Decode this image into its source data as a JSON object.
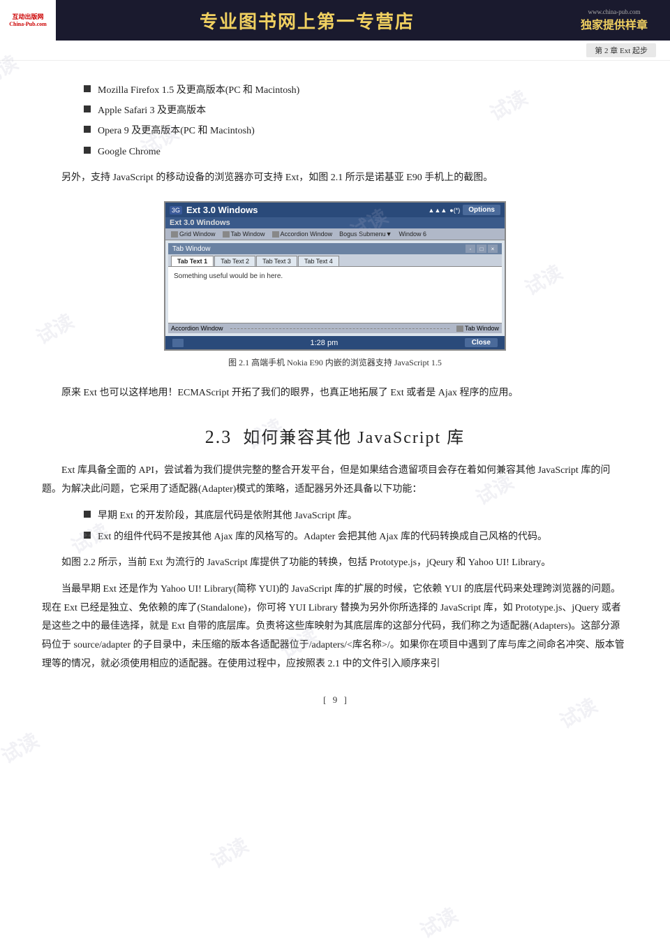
{
  "header": {
    "logo_top": "互动出版网",
    "logo_sub": "China-Pub.com",
    "center_title": "专业图书网上第一专营店",
    "right_url": "www.china-pub.com",
    "right_slogan": "独家提供样章"
  },
  "chapter_tag": "第 2 章   Ext 起步",
  "bullet_items": [
    "Mozilla Firefox 1.5 及更高版本(PC 和 Macintosh)",
    "Apple Safari 3 及更高版本",
    "Opera 9 及更高版本(PC 和 Macintosh)",
    "Google Chrome"
  ],
  "para_intro": "另外，支持 JavaScript 的移动设备的浏览器亦可支持 Ext，如图 2.1 所示是诺基亚 E90 手机上的截图。",
  "figure": {
    "top_bar_signal": "3G",
    "top_bar_title": "Ext 3.0 Windows",
    "top_bar_wifi": "▲▲▲",
    "top_bar_battery": "●(*)",
    "options_label": "Options",
    "ext_windows_label": "Ext 3.0 Windows",
    "menu_items": [
      "Grid Window",
      "Tab Window",
      "Accordion Window",
      "Bogus Submenu▼",
      "Window 6"
    ],
    "tab_window_title": "Tab Window",
    "win_buttons": [
      "-",
      "□",
      "×"
    ],
    "tabs": [
      "Tab Text 1",
      "Tab Text 2",
      "Tab Text 3",
      "Tab Text 4"
    ],
    "active_tab": 0,
    "tab_content": "Something useful would be in here.",
    "accordion_label": "Accordion Window",
    "tab_window_label2": "Tab Window",
    "phone_time": "1:28 pm",
    "close_label": "Close"
  },
  "figure_caption": "图 2.1    高端手机 Nokia E90 内嵌的浏览器支持 JavaScript 1.5",
  "para_after_figure": "原来 Ext 也可以这样地用！ECMAScript 开拓了我们的眼界，也真正地拓展了 Ext 或者是 Ajax 程序的应用。",
  "section": {
    "number": "2.3",
    "title": "如何兼容其他 JavaScript 库"
  },
  "paragraphs": [
    "Ext 库具备全面的 API，尝试着为我们提供完整的整合开发平台，但是如果结合遗留项目会存在着如何兼容其他 JavaScript 库的问题。为解决此问题，它采用了适配器(Adapter)模式的策略，适配器另外还具备以下功能：",
    "如图 2.2 所示，当前 Ext 为流行的 JavaScript 库提供了功能的转换，包括 Prototype.js，jQeury 和 Yahoo UI! Library。",
    "当最早期 Ext 还是作为 Yahoo UI! Library(简称 YUI)的 JavaScript 库的扩展的时候，它依赖 YUI 的底层代码来处理跨浏览器的问题。现在 Ext 已经是独立、免依赖的库了(Standalone)，你可将 YUI  Library 替换为另外你所选择的 JavaScript 库，如 Prototype.js、jQuery 或者是这些之中的最佳选择，就是 Ext 自带的底层库。负责将这些库映射为其底层库的这部分代码，我们称之为适配器(Adapters)。这部分源码位于 source/adapter 的子目录中，未压缩的版本各适配器位于/adapters/<库名称>/。如果你在项目中遇到了库与库之间命名冲突、版本管理等的情况，就必须使用相应的适配器。在使用过程中，应按照表 2.1 中的文件引入顺序来引"
  ],
  "sub_bullets": [
    "早期 Ext 的开发阶段，其底层代码是依附其他 JavaScript 库。",
    "Ext 的组件代码不是按其他 Ajax 库的风格写的。Adapter 会把其他 Ajax 库的代码转换成自己风格的代码。"
  ],
  "page_number": "9"
}
